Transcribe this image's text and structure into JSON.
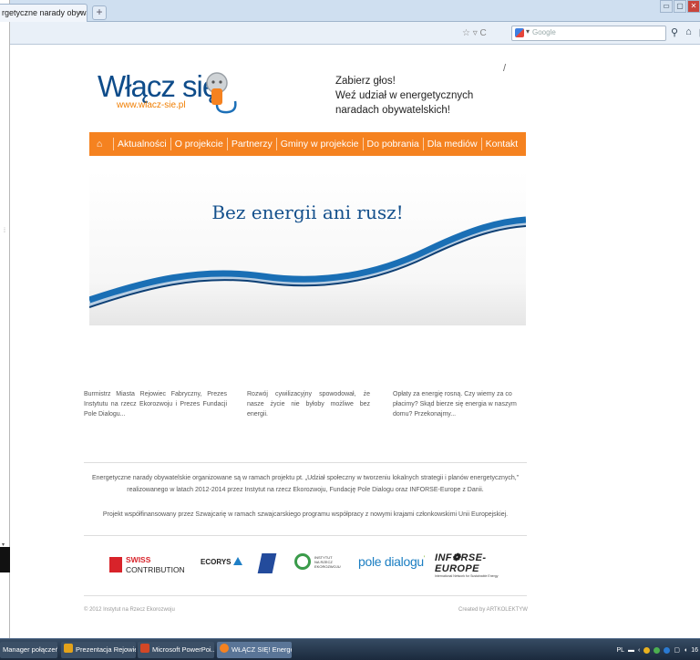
{
  "browser": {
    "tab_title": "rgetyczne narady obywa...",
    "tab_close": "×",
    "new_tab": "+",
    "url_controls": "☆ ▿ C",
    "search_placeholder": "Google",
    "search_dropdown": "▾",
    "window_buttons": [
      "▭",
      "▢",
      "✕"
    ]
  },
  "site": {
    "logo_text": "Włącz się",
    "logo_url": "www.wlacz-sie.pl",
    "slogan": [
      "Zabierz głos!",
      "Weź udział w energetycznych",
      "naradach obywatelskich!"
    ],
    "slash": "/",
    "menu": [
      "Aktualności",
      "O projekcie",
      "Partnerzy",
      "Gminy w projekcie",
      "Do pobrania",
      "Dla mediów",
      "Kontakt"
    ],
    "banner_title": "Bez energii ani rusz!",
    "columns": [
      "Burmistrz Miasta Rejowiec Fabryczny, Prezes Instytutu na rzecz Ekorozwoju i Prezes Fundacji Pole Dialogu...",
      "Rozwój cywilizacyjny spowodował, że nasze życie nie byłoby możliwe bez energii.",
      "Opłaty za energię rosną. Czy wiemy za co płacimy? Skąd bierze się energia w naszym domu? Przekonajmy..."
    ],
    "info_1": "Energetyczne narady obywatelskie organizowane są w ramach projektu pt. „Udział społeczny w tworzeniu lokalnych strategii i planów energetycznych,” realizowanego w latach 2012-2014 przez Instytut na rzecz Ekorozwoju, Fundację Pole Dialogu oraz INFORSE-Europe z Danii.",
    "info_2": "Projekt współfinansowany przez Szwajcarię w ramach szwajcarskiego programu współpracy z nowymi krajami członkowskimi Unii Europejskiej.",
    "partners": {
      "swiss_1": "SWISS",
      "swiss_2": "CONTRIBUTION",
      "ecorys": "ECORYS",
      "inst": [
        "INSTYTUT",
        "NA RZECZ",
        "EKOROZWOJU"
      ],
      "pole": "pole dialogu",
      "inforse": "INF❁RSE-EUROPE",
      "inforse_sub": "International Network for Sustainable Energy"
    },
    "footer_left": "© 2012 Instytut na Rzecz Ekorozwoju",
    "footer_right": "Created by ARTKOLEKTYW"
  },
  "taskbar": {
    "tasks": [
      {
        "label": "Manager połączeń",
        "color": "#3b4f66"
      },
      {
        "label": "Prezentacja Rejowie...",
        "color": "#3b4f66"
      },
      {
        "label": "Microsoft PowerPoi...",
        "color": "#3b4f66"
      },
      {
        "label": "WŁĄCZ SIĘ! Energet...",
        "color": "#5a7597"
      }
    ],
    "tray_lang": "PL",
    "clock": "16"
  },
  "colors": {
    "accent": "#f58220",
    "brand_blue": "#0e4c8a"
  }
}
